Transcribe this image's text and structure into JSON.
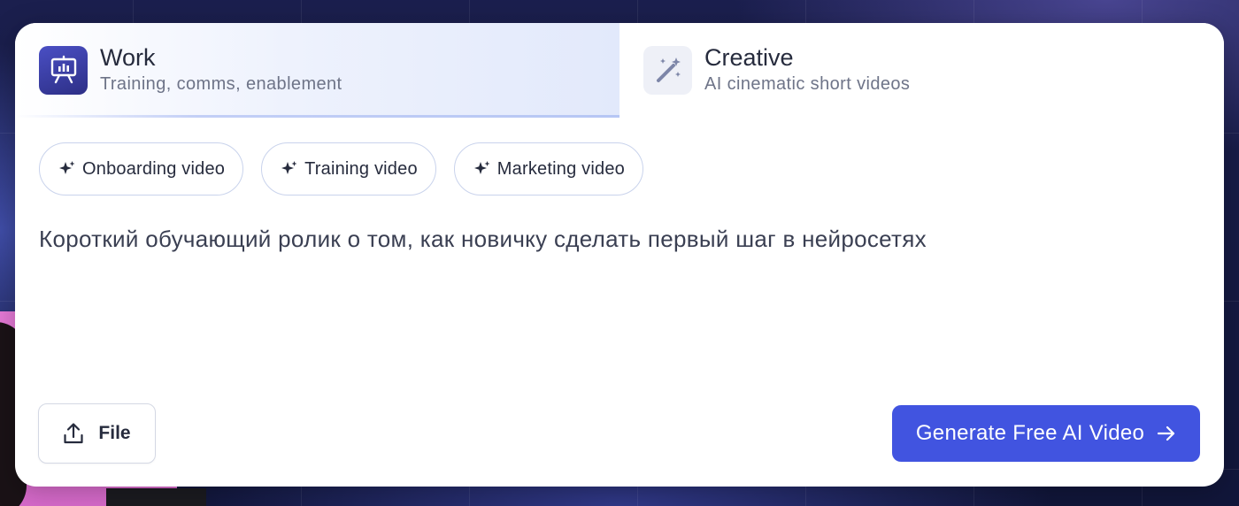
{
  "tabs": [
    {
      "title": "Work",
      "subtitle": "Training, comms, enablement",
      "icon": "presentation-board-icon",
      "active": true
    },
    {
      "title": "Creative",
      "subtitle": "AI cinematic short videos",
      "icon": "magic-wand-icon",
      "active": false
    }
  ],
  "chips": [
    {
      "label": "Onboarding video",
      "icon": "sparkle-icon"
    },
    {
      "label": "Training video",
      "icon": "sparkle-icon"
    },
    {
      "label": "Marketing video",
      "icon": "sparkle-icon"
    }
  ],
  "prompt": {
    "value": "Короткий обучающий ролик о том, как новичку сделать первый шаг в нейросетях"
  },
  "file_button": {
    "label": "File",
    "icon": "upload-icon"
  },
  "generate_button": {
    "label": "Generate Free AI Video",
    "icon": "arrow-right-icon"
  },
  "colors": {
    "accent": "#4154e0",
    "work_icon_bg": "#3a3ea8",
    "text": "#262b3d",
    "muted": "#6e7488",
    "chip_border": "#c9d3ec"
  }
}
